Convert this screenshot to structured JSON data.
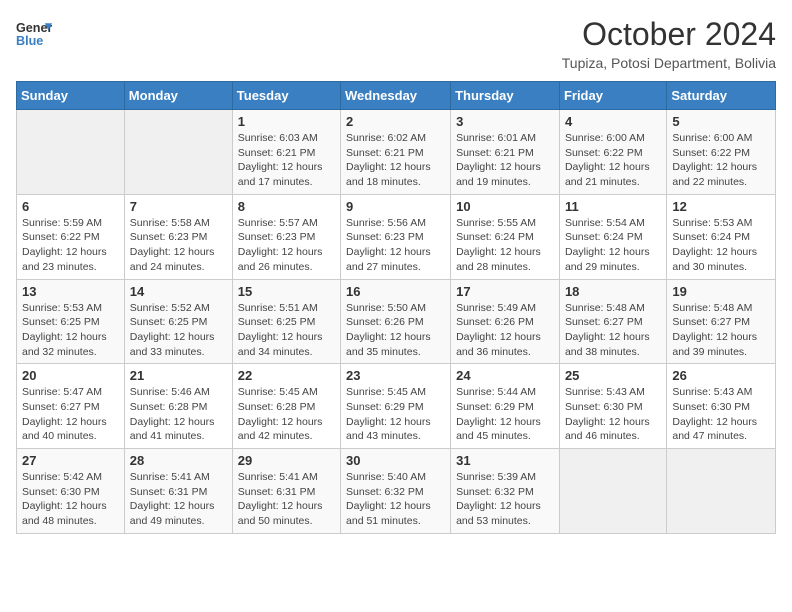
{
  "header": {
    "logo_line1": "General",
    "logo_line2": "Blue",
    "title": "October 2024",
    "subtitle": "Tupiza, Potosi Department, Bolivia"
  },
  "weekdays": [
    "Sunday",
    "Monday",
    "Tuesday",
    "Wednesday",
    "Thursday",
    "Friday",
    "Saturday"
  ],
  "weeks": [
    [
      {
        "day": "",
        "info": ""
      },
      {
        "day": "",
        "info": ""
      },
      {
        "day": "1",
        "info": "Sunrise: 6:03 AM\nSunset: 6:21 PM\nDaylight: 12 hours and 17 minutes."
      },
      {
        "day": "2",
        "info": "Sunrise: 6:02 AM\nSunset: 6:21 PM\nDaylight: 12 hours and 18 minutes."
      },
      {
        "day": "3",
        "info": "Sunrise: 6:01 AM\nSunset: 6:21 PM\nDaylight: 12 hours and 19 minutes."
      },
      {
        "day": "4",
        "info": "Sunrise: 6:00 AM\nSunset: 6:22 PM\nDaylight: 12 hours and 21 minutes."
      },
      {
        "day": "5",
        "info": "Sunrise: 6:00 AM\nSunset: 6:22 PM\nDaylight: 12 hours and 22 minutes."
      }
    ],
    [
      {
        "day": "6",
        "info": "Sunrise: 5:59 AM\nSunset: 6:22 PM\nDaylight: 12 hours and 23 minutes."
      },
      {
        "day": "7",
        "info": "Sunrise: 5:58 AM\nSunset: 6:23 PM\nDaylight: 12 hours and 24 minutes."
      },
      {
        "day": "8",
        "info": "Sunrise: 5:57 AM\nSunset: 6:23 PM\nDaylight: 12 hours and 26 minutes."
      },
      {
        "day": "9",
        "info": "Sunrise: 5:56 AM\nSunset: 6:23 PM\nDaylight: 12 hours and 27 minutes."
      },
      {
        "day": "10",
        "info": "Sunrise: 5:55 AM\nSunset: 6:24 PM\nDaylight: 12 hours and 28 minutes."
      },
      {
        "day": "11",
        "info": "Sunrise: 5:54 AM\nSunset: 6:24 PM\nDaylight: 12 hours and 29 minutes."
      },
      {
        "day": "12",
        "info": "Sunrise: 5:53 AM\nSunset: 6:24 PM\nDaylight: 12 hours and 30 minutes."
      }
    ],
    [
      {
        "day": "13",
        "info": "Sunrise: 5:53 AM\nSunset: 6:25 PM\nDaylight: 12 hours and 32 minutes."
      },
      {
        "day": "14",
        "info": "Sunrise: 5:52 AM\nSunset: 6:25 PM\nDaylight: 12 hours and 33 minutes."
      },
      {
        "day": "15",
        "info": "Sunrise: 5:51 AM\nSunset: 6:25 PM\nDaylight: 12 hours and 34 minutes."
      },
      {
        "day": "16",
        "info": "Sunrise: 5:50 AM\nSunset: 6:26 PM\nDaylight: 12 hours and 35 minutes."
      },
      {
        "day": "17",
        "info": "Sunrise: 5:49 AM\nSunset: 6:26 PM\nDaylight: 12 hours and 36 minutes."
      },
      {
        "day": "18",
        "info": "Sunrise: 5:48 AM\nSunset: 6:27 PM\nDaylight: 12 hours and 38 minutes."
      },
      {
        "day": "19",
        "info": "Sunrise: 5:48 AM\nSunset: 6:27 PM\nDaylight: 12 hours and 39 minutes."
      }
    ],
    [
      {
        "day": "20",
        "info": "Sunrise: 5:47 AM\nSunset: 6:27 PM\nDaylight: 12 hours and 40 minutes."
      },
      {
        "day": "21",
        "info": "Sunrise: 5:46 AM\nSunset: 6:28 PM\nDaylight: 12 hours and 41 minutes."
      },
      {
        "day": "22",
        "info": "Sunrise: 5:45 AM\nSunset: 6:28 PM\nDaylight: 12 hours and 42 minutes."
      },
      {
        "day": "23",
        "info": "Sunrise: 5:45 AM\nSunset: 6:29 PM\nDaylight: 12 hours and 43 minutes."
      },
      {
        "day": "24",
        "info": "Sunrise: 5:44 AM\nSunset: 6:29 PM\nDaylight: 12 hours and 45 minutes."
      },
      {
        "day": "25",
        "info": "Sunrise: 5:43 AM\nSunset: 6:30 PM\nDaylight: 12 hours and 46 minutes."
      },
      {
        "day": "26",
        "info": "Sunrise: 5:43 AM\nSunset: 6:30 PM\nDaylight: 12 hours and 47 minutes."
      }
    ],
    [
      {
        "day": "27",
        "info": "Sunrise: 5:42 AM\nSunset: 6:30 PM\nDaylight: 12 hours and 48 minutes."
      },
      {
        "day": "28",
        "info": "Sunrise: 5:41 AM\nSunset: 6:31 PM\nDaylight: 12 hours and 49 minutes."
      },
      {
        "day": "29",
        "info": "Sunrise: 5:41 AM\nSunset: 6:31 PM\nDaylight: 12 hours and 50 minutes."
      },
      {
        "day": "30",
        "info": "Sunrise: 5:40 AM\nSunset: 6:32 PM\nDaylight: 12 hours and 51 minutes."
      },
      {
        "day": "31",
        "info": "Sunrise: 5:39 AM\nSunset: 6:32 PM\nDaylight: 12 hours and 53 minutes."
      },
      {
        "day": "",
        "info": ""
      },
      {
        "day": "",
        "info": ""
      }
    ]
  ]
}
